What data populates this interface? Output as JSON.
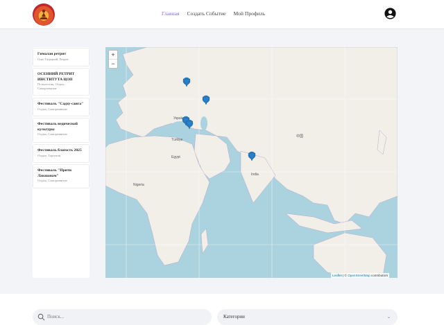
{
  "nav": {
    "items": [
      "Главная",
      "Создать Событие",
      "Мой Профиль"
    ],
    "active_index": 0
  },
  "events": [
    {
      "title": "Гималаи ретрит",
      "subtitle": "Олег Гадецкий, Ретрит"
    },
    {
      "title": "ОСЕННИЙ РЕТРИТ ИНСТИТУТА ЦОП",
      "subtitle": "Психология, Отдых, Саморазвитие"
    },
    {
      "title": "Фестиваль \"Садху-санга\"",
      "subtitle": "Отдых, Саморазвитие"
    },
    {
      "title": "Фестиваль ведической культуры",
      "subtitle": "Отдых, Саморазвитие"
    },
    {
      "title": "Фестиваль благость 2025",
      "subtitle": "Отдых, Торговля"
    },
    {
      "title": "Фестиваль \"Прити Лакшанам\"",
      "subtitle": "Отдых, Саморазвитие"
    }
  ],
  "map": {
    "zoom_in": "+",
    "zoom_out": "−",
    "attribution_leaflet": "Leaflet",
    "attribution_sep": " | © ",
    "attribution_osm": "OpenStreetMap",
    "attribution_tail": " contributors",
    "labels": [
      "Україна",
      "Türkiye",
      "India",
      "Egypt",
      "Nigeria",
      "中国"
    ]
  },
  "search": {
    "placeholder": "Поиск..."
  },
  "category": {
    "value": "Категории"
  },
  "colors": {
    "accent": "#8a6bd6",
    "water": "#aad3df",
    "land": "#f2efe9",
    "marker": "#2a81cb"
  }
}
